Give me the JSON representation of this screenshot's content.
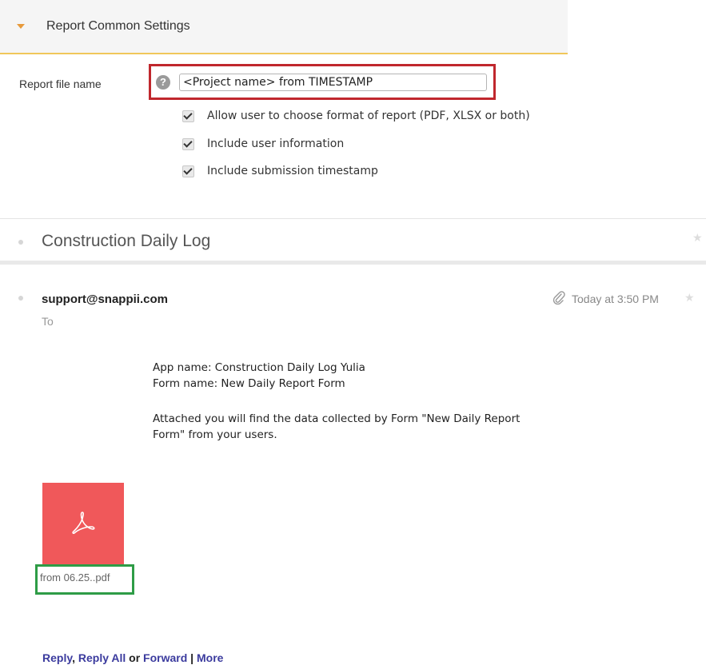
{
  "settings": {
    "title": "Report Common Settings",
    "field_label": "Report file name",
    "help_glyph": "?",
    "filename_value": "<Project name> from TIMESTAMP",
    "checkboxes": [
      {
        "label": "Allow user to choose format of report (PDF, XLSX or both)",
        "checked": true
      },
      {
        "label": "Include user information",
        "checked": true
      },
      {
        "label": "Include submission timestamp",
        "checked": true
      }
    ],
    "colors": {
      "header_accent": "#f0c75a",
      "caret": "#e79a3c",
      "highlight_red": "#c0272d"
    }
  },
  "email": {
    "subject": "Construction Daily Log",
    "sender": "support@snappii.com",
    "to_label": "To",
    "time": "Today at 3:50 PM",
    "icons": {
      "attachment": "paperclip-icon",
      "star": "star-icon",
      "pdf": "acrobat-icon"
    },
    "body": {
      "line1": "App name: Construction Daily Log Yulia",
      "line2": "Form name: New Daily Report Form",
      "line3": "Attached you will find the data collected by Form \"New Daily Report",
      "line4": "Form\" from your users."
    },
    "attachment": {
      "filename": "from 06.25..pdf",
      "thumb_color": "#f0585a",
      "highlight_color": "#2e9c46"
    },
    "actions": {
      "reply": "Reply",
      "reply_all": "Reply All",
      "or_text": "or",
      "forward": "Forward",
      "separator": "|",
      "more": "More"
    }
  }
}
